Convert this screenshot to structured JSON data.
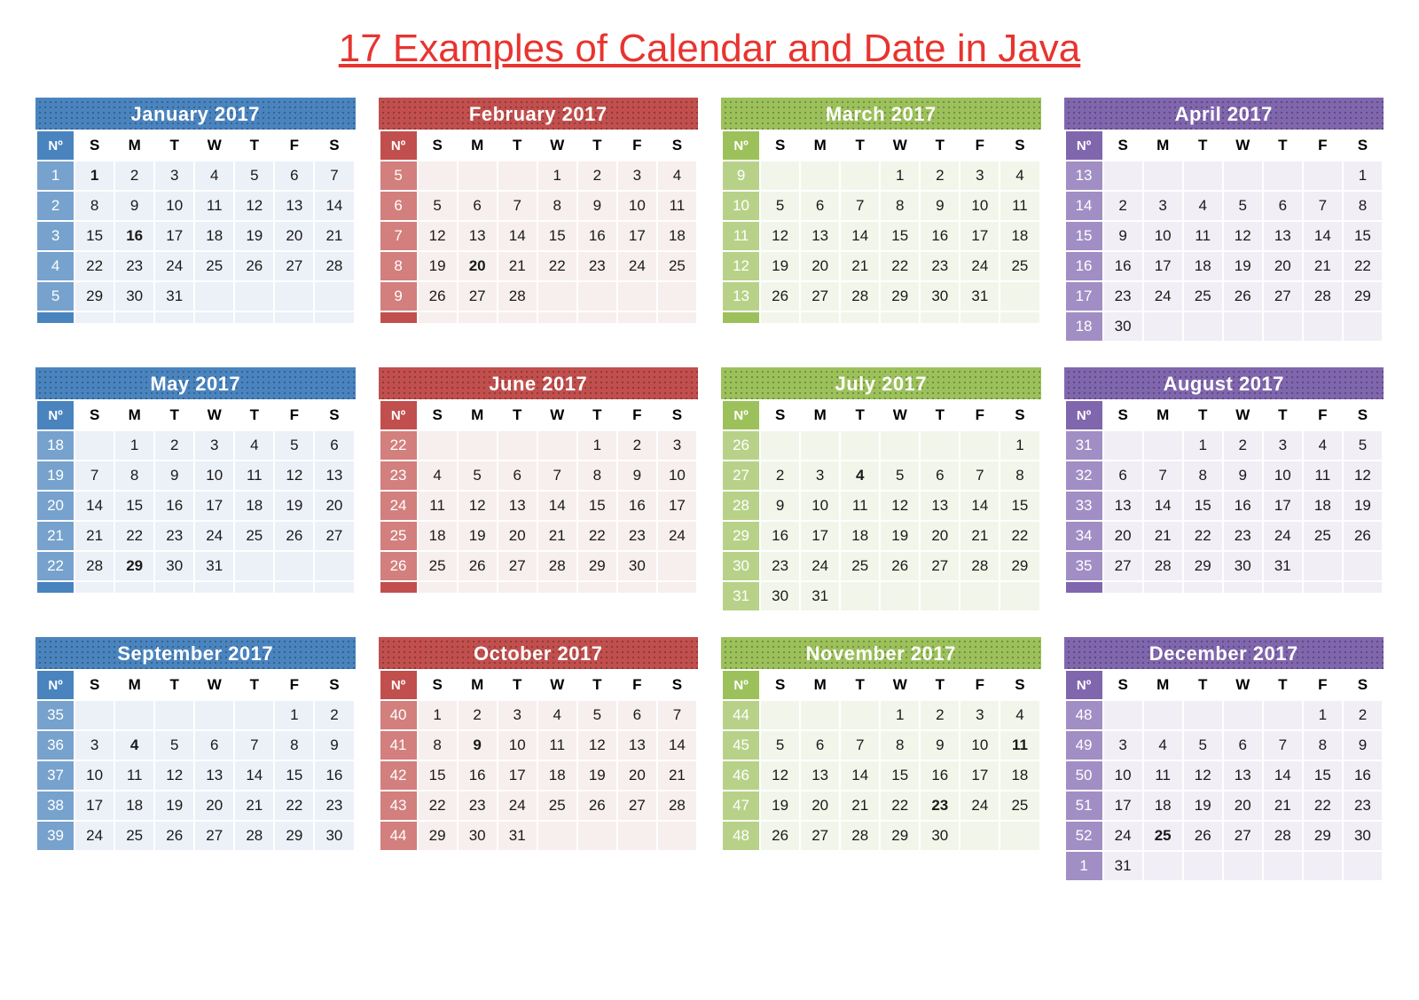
{
  "title": "17 Examples of Calendar and Date in Java",
  "weekNumberLabel": "Nº",
  "dayHeaders": [
    "S",
    "M",
    "T",
    "W",
    "T",
    "F",
    "S"
  ],
  "months": [
    {
      "name": "January 2017",
      "color": "blue",
      "weeks": [
        {
          "num": "1",
          "days": [
            "1",
            "2",
            "3",
            "4",
            "5",
            "6",
            "7"
          ],
          "bold": [
            0
          ]
        },
        {
          "num": "2",
          "days": [
            "8",
            "9",
            "10",
            "11",
            "12",
            "13",
            "14"
          ]
        },
        {
          "num": "3",
          "days": [
            "15",
            "16",
            "17",
            "18",
            "19",
            "20",
            "21"
          ],
          "bold": [
            1
          ]
        },
        {
          "num": "4",
          "days": [
            "22",
            "23",
            "24",
            "25",
            "26",
            "27",
            "28"
          ]
        },
        {
          "num": "5",
          "days": [
            "29",
            "30",
            "31",
            "",
            "",
            "",
            ""
          ]
        },
        {
          "num": "",
          "days": [
            "",
            "",
            "",
            "",
            "",
            "",
            ""
          ]
        }
      ]
    },
    {
      "name": "February 2017",
      "color": "red",
      "weeks": [
        {
          "num": "5",
          "days": [
            "",
            "",
            "",
            "1",
            "2",
            "3",
            "4"
          ]
        },
        {
          "num": "6",
          "days": [
            "5",
            "6",
            "7",
            "8",
            "9",
            "10",
            "11"
          ]
        },
        {
          "num": "7",
          "days": [
            "12",
            "13",
            "14",
            "15",
            "16",
            "17",
            "18"
          ]
        },
        {
          "num": "8",
          "days": [
            "19",
            "20",
            "21",
            "22",
            "23",
            "24",
            "25"
          ],
          "bold": [
            1
          ]
        },
        {
          "num": "9",
          "days": [
            "26",
            "27",
            "28",
            "",
            "",
            "",
            ""
          ]
        },
        {
          "num": "",
          "days": [
            "",
            "",
            "",
            "",
            "",
            "",
            ""
          ]
        }
      ]
    },
    {
      "name": "March 2017",
      "color": "green",
      "weeks": [
        {
          "num": "9",
          "days": [
            "",
            "",
            "",
            "1",
            "2",
            "3",
            "4"
          ]
        },
        {
          "num": "10",
          "days": [
            "5",
            "6",
            "7",
            "8",
            "9",
            "10",
            "11"
          ]
        },
        {
          "num": "11",
          "days": [
            "12",
            "13",
            "14",
            "15",
            "16",
            "17",
            "18"
          ]
        },
        {
          "num": "12",
          "days": [
            "19",
            "20",
            "21",
            "22",
            "23",
            "24",
            "25"
          ]
        },
        {
          "num": "13",
          "days": [
            "26",
            "27",
            "28",
            "29",
            "30",
            "31",
            ""
          ]
        },
        {
          "num": "",
          "days": [
            "",
            "",
            "",
            "",
            "",
            "",
            ""
          ]
        }
      ]
    },
    {
      "name": "April 2017",
      "color": "purple",
      "weeks": [
        {
          "num": "13",
          "days": [
            "",
            "",
            "",
            "",
            "",
            "",
            "1"
          ]
        },
        {
          "num": "14",
          "days": [
            "2",
            "3",
            "4",
            "5",
            "6",
            "7",
            "8"
          ]
        },
        {
          "num": "15",
          "days": [
            "9",
            "10",
            "11",
            "12",
            "13",
            "14",
            "15"
          ]
        },
        {
          "num": "16",
          "days": [
            "16",
            "17",
            "18",
            "19",
            "20",
            "21",
            "22"
          ]
        },
        {
          "num": "17",
          "days": [
            "23",
            "24",
            "25",
            "26",
            "27",
            "28",
            "29"
          ]
        },
        {
          "num": "18",
          "days": [
            "30",
            "",
            "",
            "",
            "",
            "",
            ""
          ]
        }
      ]
    },
    {
      "name": "May 2017",
      "color": "blue",
      "weeks": [
        {
          "num": "18",
          "days": [
            "",
            "1",
            "2",
            "3",
            "4",
            "5",
            "6"
          ]
        },
        {
          "num": "19",
          "days": [
            "7",
            "8",
            "9",
            "10",
            "11",
            "12",
            "13"
          ]
        },
        {
          "num": "20",
          "days": [
            "14",
            "15",
            "16",
            "17",
            "18",
            "19",
            "20"
          ]
        },
        {
          "num": "21",
          "days": [
            "21",
            "22",
            "23",
            "24",
            "25",
            "26",
            "27"
          ]
        },
        {
          "num": "22",
          "days": [
            "28",
            "29",
            "30",
            "31",
            "",
            "",
            ""
          ],
          "bold": [
            1
          ]
        },
        {
          "num": "",
          "days": [
            "",
            "",
            "",
            "",
            "",
            "",
            ""
          ]
        }
      ]
    },
    {
      "name": "June 2017",
      "color": "red",
      "weeks": [
        {
          "num": "22",
          "days": [
            "",
            "",
            "",
            "",
            "1",
            "2",
            "3"
          ]
        },
        {
          "num": "23",
          "days": [
            "4",
            "5",
            "6",
            "7",
            "8",
            "9",
            "10"
          ]
        },
        {
          "num": "24",
          "days": [
            "11",
            "12",
            "13",
            "14",
            "15",
            "16",
            "17"
          ]
        },
        {
          "num": "25",
          "days": [
            "18",
            "19",
            "20",
            "21",
            "22",
            "23",
            "24"
          ]
        },
        {
          "num": "26",
          "days": [
            "25",
            "26",
            "27",
            "28",
            "29",
            "30",
            ""
          ]
        },
        {
          "num": "",
          "days": [
            "",
            "",
            "",
            "",
            "",
            "",
            ""
          ]
        }
      ]
    },
    {
      "name": "July 2017",
      "color": "green",
      "weeks": [
        {
          "num": "26",
          "days": [
            "",
            "",
            "",
            "",
            "",
            "",
            "1"
          ]
        },
        {
          "num": "27",
          "days": [
            "2",
            "3",
            "4",
            "5",
            "6",
            "7",
            "8"
          ],
          "bold": [
            2
          ]
        },
        {
          "num": "28",
          "days": [
            "9",
            "10",
            "11",
            "12",
            "13",
            "14",
            "15"
          ]
        },
        {
          "num": "29",
          "days": [
            "16",
            "17",
            "18",
            "19",
            "20",
            "21",
            "22"
          ]
        },
        {
          "num": "30",
          "days": [
            "23",
            "24",
            "25",
            "26",
            "27",
            "28",
            "29"
          ]
        },
        {
          "num": "31",
          "days": [
            "30",
            "31",
            "",
            "",
            "",
            "",
            ""
          ]
        }
      ]
    },
    {
      "name": "August 2017",
      "color": "purple",
      "weeks": [
        {
          "num": "31",
          "days": [
            "",
            "",
            "1",
            "2",
            "3",
            "4",
            "5"
          ]
        },
        {
          "num": "32",
          "days": [
            "6",
            "7",
            "8",
            "9",
            "10",
            "11",
            "12"
          ]
        },
        {
          "num": "33",
          "days": [
            "13",
            "14",
            "15",
            "16",
            "17",
            "18",
            "19"
          ]
        },
        {
          "num": "34",
          "days": [
            "20",
            "21",
            "22",
            "23",
            "24",
            "25",
            "26"
          ]
        },
        {
          "num": "35",
          "days": [
            "27",
            "28",
            "29",
            "30",
            "31",
            "",
            ""
          ]
        },
        {
          "num": "",
          "days": [
            "",
            "",
            "",
            "",
            "",
            "",
            ""
          ]
        }
      ]
    },
    {
      "name": "September 2017",
      "color": "blue",
      "weeks": [
        {
          "num": "35",
          "days": [
            "",
            "",
            "",
            "",
            "",
            "1",
            "2"
          ]
        },
        {
          "num": "36",
          "days": [
            "3",
            "4",
            "5",
            "6",
            "7",
            "8",
            "9"
          ],
          "bold": [
            1
          ]
        },
        {
          "num": "37",
          "days": [
            "10",
            "11",
            "12",
            "13",
            "14",
            "15",
            "16"
          ]
        },
        {
          "num": "38",
          "days": [
            "17",
            "18",
            "19",
            "20",
            "21",
            "22",
            "23"
          ]
        },
        {
          "num": "39",
          "days": [
            "24",
            "25",
            "26",
            "27",
            "28",
            "29",
            "30"
          ]
        }
      ]
    },
    {
      "name": "October 2017",
      "color": "red",
      "weeks": [
        {
          "num": "40",
          "days": [
            "1",
            "2",
            "3",
            "4",
            "5",
            "6",
            "7"
          ]
        },
        {
          "num": "41",
          "days": [
            "8",
            "9",
            "10",
            "11",
            "12",
            "13",
            "14"
          ],
          "bold": [
            1
          ]
        },
        {
          "num": "42",
          "days": [
            "15",
            "16",
            "17",
            "18",
            "19",
            "20",
            "21"
          ]
        },
        {
          "num": "43",
          "days": [
            "22",
            "23",
            "24",
            "25",
            "26",
            "27",
            "28"
          ]
        },
        {
          "num": "44",
          "days": [
            "29",
            "30",
            "31",
            "",
            "",
            "",
            ""
          ]
        }
      ]
    },
    {
      "name": "November 2017",
      "color": "green",
      "weeks": [
        {
          "num": "44",
          "days": [
            "",
            "",
            "",
            "1",
            "2",
            "3",
            "4"
          ]
        },
        {
          "num": "45",
          "days": [
            "5",
            "6",
            "7",
            "8",
            "9",
            "10",
            "11"
          ],
          "bold": [
            6
          ]
        },
        {
          "num": "46",
          "days": [
            "12",
            "13",
            "14",
            "15",
            "16",
            "17",
            "18"
          ]
        },
        {
          "num": "47",
          "days": [
            "19",
            "20",
            "21",
            "22",
            "23",
            "24",
            "25"
          ],
          "bold": [
            4
          ]
        },
        {
          "num": "48",
          "days": [
            "26",
            "27",
            "28",
            "29",
            "30",
            "",
            ""
          ]
        }
      ]
    },
    {
      "name": "December 2017",
      "color": "purple",
      "weeks": [
        {
          "num": "48",
          "days": [
            "",
            "",
            "",
            "",
            "",
            "1",
            "2"
          ]
        },
        {
          "num": "49",
          "days": [
            "3",
            "4",
            "5",
            "6",
            "7",
            "8",
            "9"
          ]
        },
        {
          "num": "50",
          "days": [
            "10",
            "11",
            "12",
            "13",
            "14",
            "15",
            "16"
          ]
        },
        {
          "num": "51",
          "days": [
            "17",
            "18",
            "19",
            "20",
            "21",
            "22",
            "23"
          ]
        },
        {
          "num": "52",
          "days": [
            "24",
            "25",
            "26",
            "27",
            "28",
            "29",
            "30"
          ],
          "bold": [
            1
          ]
        },
        {
          "num": "1",
          "days": [
            "31",
            "",
            "",
            "",
            "",
            "",
            ""
          ]
        }
      ]
    }
  ]
}
